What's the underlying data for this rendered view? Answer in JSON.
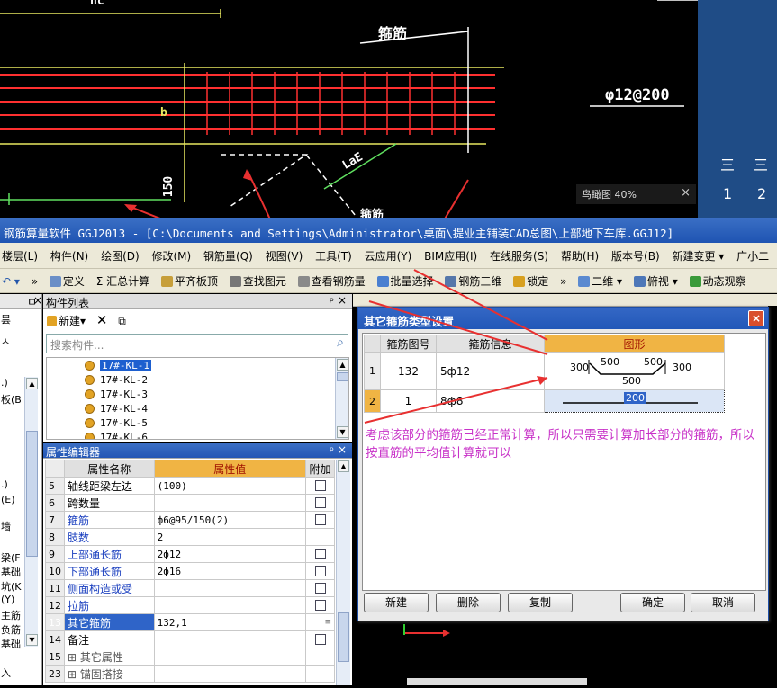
{
  "cad": {
    "label_hoop": "箍筋",
    "label_rebar": "φ12@200",
    "label_b": "b",
    "label_150": "150",
    "label_lae": "LaE",
    "label_top": "nc",
    "label_bottom": "箍筋"
  },
  "birdeye": {
    "label": "鸟瞰图 40%",
    "close": "×"
  },
  "right_panel": {
    "icon1": "三",
    "icon2": "三",
    "num1": "1",
    "num2": "2"
  },
  "window": {
    "title": "钢筋算量软件 GGJ2013 - [C:\\Documents and Settings\\Administrator\\桌面\\提业主铺装CAD总图\\上部地下车库.GGJ12]"
  },
  "menubar": {
    "items": [
      "楼层(L)",
      "构件(N)",
      "绘图(D)",
      "修改(M)",
      "钢筋量(Q)",
      "视图(V)",
      "工具(T)",
      "云应用(Y)",
      "BIM应用(I)",
      "在线服务(S)",
      "帮助(H)",
      "版本号(B)",
      "新建变更 ▾",
      "广小二"
    ]
  },
  "toolbar": {
    "items": [
      "定义",
      "Σ 汇总计算",
      "平齐板顶",
      "查找图元",
      "查看钢筋量",
      "批量选择",
      "钢筋三维",
      "锁定",
      "二维 ▾",
      "俯视 ▾",
      "动态观察"
    ]
  },
  "left_strip": {
    "items": [
      "昙",
      "ㅅ",
      ".)",
      "板(B",
      ".)",
      "(E)",
      "墙",
      "梁(F",
      "基础",
      "坑(K",
      "(Y)",
      "主筋",
      "负筋",
      "基础",
      "入"
    ]
  },
  "component_list": {
    "title": "构件列表",
    "new_label": "新建▾",
    "search_placeholder": "搜索构件...",
    "items": [
      "17#-KL-1",
      "17#-KL-2",
      "17#-KL-3",
      "17#-KL-4",
      "17#-KL-5",
      "17#-KL-6"
    ]
  },
  "property_editor": {
    "title": "属性编辑器",
    "col_name": "属性名称",
    "col_value": "属性值",
    "col_append": "附加",
    "rows": [
      {
        "num": "5",
        "name": "轴线距梁左边",
        "value": "(100)",
        "blue": false,
        "check": true
      },
      {
        "num": "6",
        "name": "跨数量",
        "value": "",
        "blue": false,
        "check": true
      },
      {
        "num": "7",
        "name": "箍筋",
        "value": "ф6@95/150(2)",
        "blue": true,
        "check": true
      },
      {
        "num": "8",
        "name": "肢数",
        "value": "2",
        "blue": true,
        "check": false
      },
      {
        "num": "9",
        "name": "上部通长筋",
        "value": "2ф12",
        "blue": true,
        "check": true
      },
      {
        "num": "10",
        "name": "下部通长筋",
        "value": "2ф16",
        "blue": true,
        "check": true
      },
      {
        "num": "11",
        "name": "侧面构造或受",
        "value": "",
        "blue": true,
        "check": true
      },
      {
        "num": "12",
        "name": "拉筋",
        "value": "",
        "blue": true,
        "check": true
      },
      {
        "num": "13",
        "name": "其它箍筋",
        "value": "132,1",
        "blue": false,
        "check": false
      },
      {
        "num": "14",
        "name": "备注",
        "value": "",
        "blue": false,
        "check": true
      },
      {
        "num": "15",
        "name": "⊞ 其它属性",
        "value": "",
        "blue": false,
        "check": false
      },
      {
        "num": "23",
        "name": "⊞ 锚固搭接",
        "value": "",
        "blue": false,
        "check": false
      }
    ]
  },
  "dialog": {
    "title": "其它箍筋类型设置",
    "close": "×",
    "col_fig_no": "箍筋图号",
    "col_info": "箍筋信息",
    "col_shape": "图形",
    "rows": [
      {
        "idx": "1",
        "fig_no": "132",
        "info": "5ф12",
        "dims": [
          "300",
          "500",
          "500",
          "300",
          "500"
        ]
      },
      {
        "idx": "2",
        "fig_no": "1",
        "info": "8ф8",
        "dims": [
          "200"
        ]
      }
    ],
    "note": "考虑该部分的箍筋已经正常计算，所以只需要计算加长部分的箍筋，所以按直筋的平均值计算就可以",
    "buttons": {
      "new": "新建",
      "delete": "删除",
      "copy": "复制",
      "ok": "确定",
      "cancel": "取消"
    }
  },
  "colors": {
    "accent": "#2f64c8",
    "annotation": "#c832c8",
    "arrow": "#e83030",
    "header_orange": "#f0b444"
  }
}
